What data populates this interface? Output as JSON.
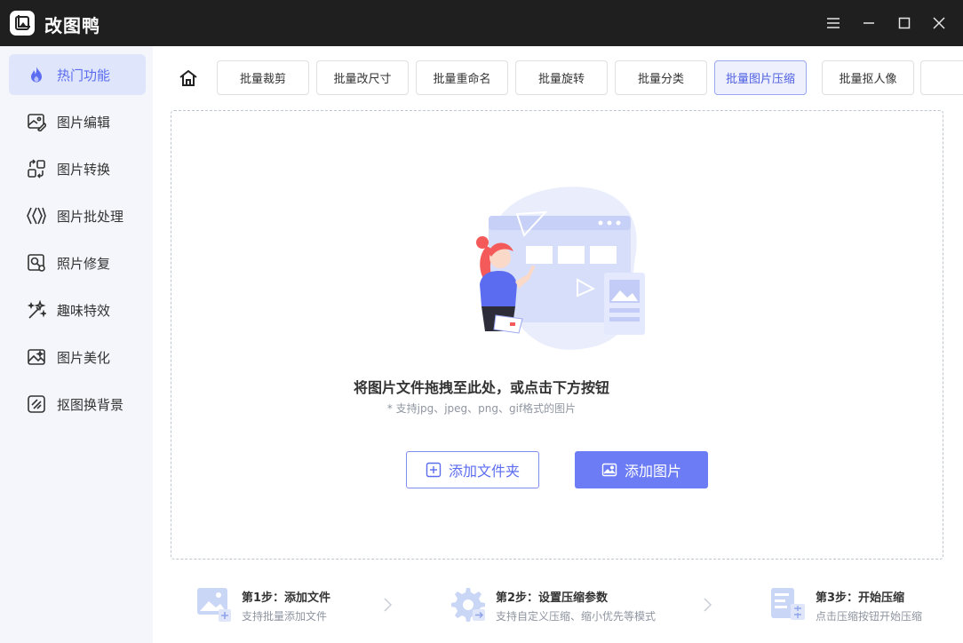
{
  "app": {
    "title": "改图鸭"
  },
  "window_controls": [
    "menu-icon",
    "minimize-icon",
    "maximize-icon",
    "close-icon"
  ],
  "sidebar": {
    "items": [
      {
        "label": "热门功能",
        "icon": "flame-icon",
        "active": true
      },
      {
        "label": "图片编辑",
        "icon": "image-edit-icon",
        "active": false
      },
      {
        "label": "图片转换",
        "icon": "convert-icon",
        "active": false
      },
      {
        "label": "图片批处理",
        "icon": "batch-icon",
        "active": false
      },
      {
        "label": "照片修复",
        "icon": "photo-repair-icon",
        "active": false
      },
      {
        "label": "趣味特效",
        "icon": "magic-wand-icon",
        "active": false
      },
      {
        "label": "图片美化",
        "icon": "beautify-icon",
        "active": false
      },
      {
        "label": "抠图换背景",
        "icon": "cutout-icon",
        "active": false
      }
    ]
  },
  "toolbar": {
    "home_icon": "home-icon",
    "tabs": [
      {
        "label": "批量裁剪",
        "active": false
      },
      {
        "label": "批量改尺寸",
        "active": false
      },
      {
        "label": "批量重命名",
        "active": false
      },
      {
        "label": "批量旋转",
        "active": false
      },
      {
        "label": "批量分类",
        "active": false
      },
      {
        "label": "批量图片压缩",
        "active": true
      },
      {
        "label": "批量抠人像",
        "active": false
      }
    ]
  },
  "dropzone": {
    "title": "将图片文件拖拽至此处，或点击下方按钮",
    "subtitle": "* 支持jpg、jpeg、png、gif格式的图片",
    "add_folder_label": "添加文件夹",
    "add_image_label": "添加图片"
  },
  "steps": [
    {
      "title": "第1步：添加文件",
      "desc": "支持批量添加文件"
    },
    {
      "title": "第2步：设置压缩参数",
      "desc": "支持自定义压缩、缩小优先等模式"
    },
    {
      "title": "第3步：开始压缩",
      "desc": "点击压缩按钮开始压缩"
    }
  ],
  "colors": {
    "accent": "#6c7cf5",
    "titlebar": "#1f1f1f",
    "sidebar_bg": "#f4f6fb",
    "active_bg": "#dfe5fb"
  }
}
